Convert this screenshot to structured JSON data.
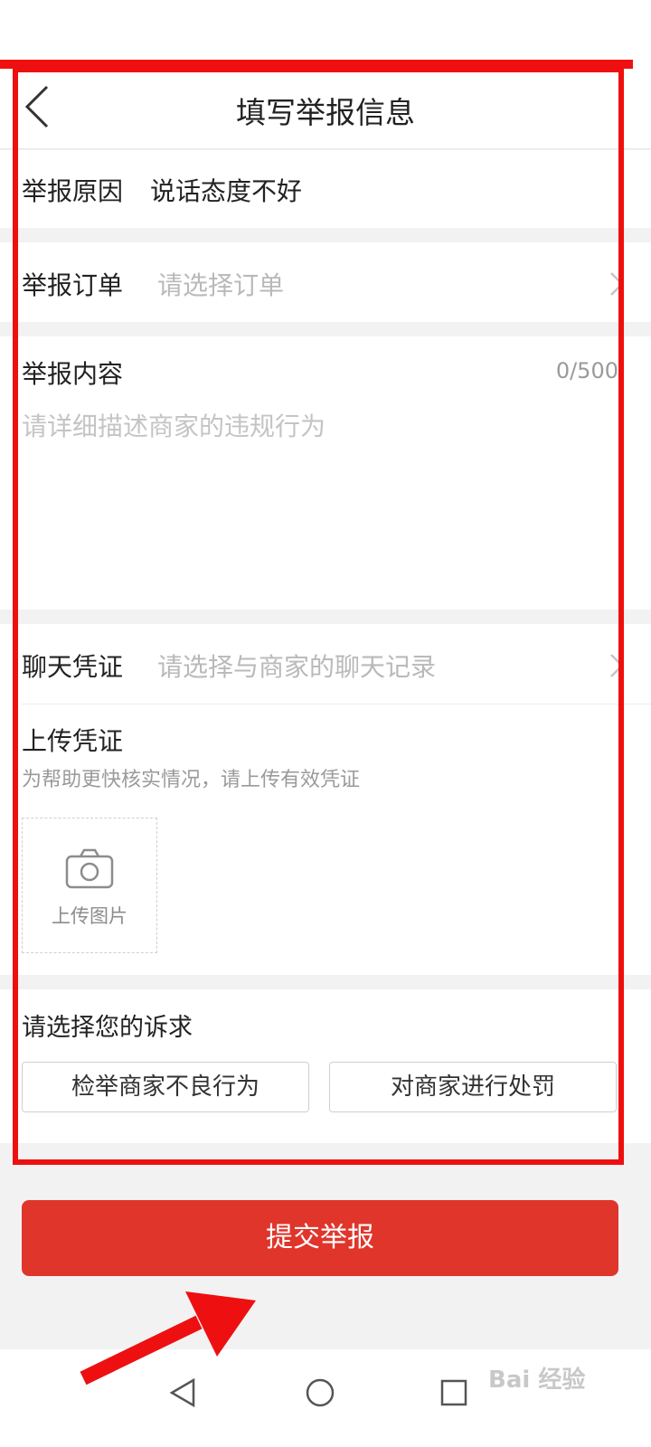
{
  "header": {
    "title": "填写举报信息"
  },
  "report_reason": {
    "label": "举报原因",
    "value": "说话态度不好"
  },
  "report_order": {
    "label": "举报订单",
    "placeholder": "请选择订单"
  },
  "report_content": {
    "label": "举报内容",
    "counter": "0/500",
    "placeholder": "请详细描述商家的违规行为"
  },
  "chat_evidence": {
    "label": "聊天凭证",
    "placeholder": "请选择与商家的聊天记录"
  },
  "upload_evidence": {
    "label": "上传凭证",
    "hint": "为帮助更快核实情况，请上传有效凭证",
    "upload_label": "上传图片"
  },
  "appeal": {
    "label": "请选择您的诉求",
    "options": [
      "检举商家不良行为",
      "对商家进行处罚"
    ]
  },
  "submit": {
    "label": "提交举报"
  },
  "icons": {
    "back": "chevron-left-icon",
    "chevron": "chevron-right-icon",
    "camera": "camera-icon",
    "nav": [
      "triangle-back-icon",
      "circle-home-icon",
      "square-recents-icon"
    ]
  },
  "colors": {
    "accent": "#e0352b",
    "annotation": "#ee1010"
  },
  "watermark": {
    "text": "Bai 经验"
  }
}
